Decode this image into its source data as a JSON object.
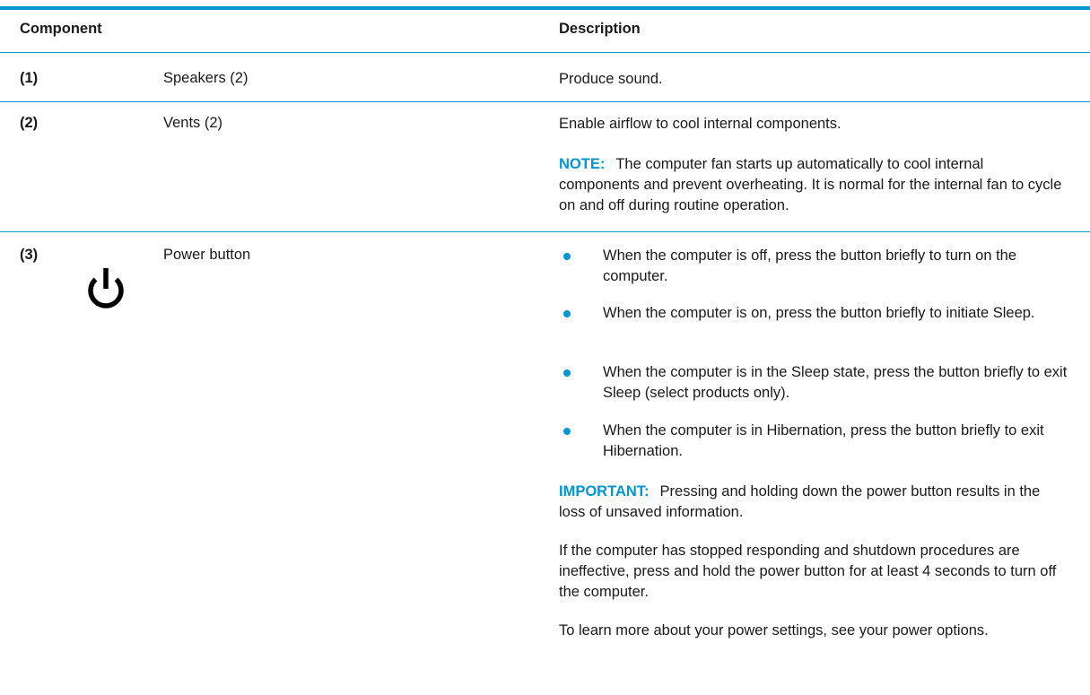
{
  "header": {
    "component": "Component",
    "description": "Description"
  },
  "rows": [
    {
      "number": "(1)",
      "name": "Speakers (2)",
      "description": "Produce sound."
    },
    {
      "number": "(2)",
      "name": "Vents (2)",
      "description": "Enable airflow to cool internal components.",
      "note_label": "NOTE:",
      "note_text": "The computer fan starts up automatically to cool internal components and prevent overheating. It is normal for the internal fan to cycle on and off during routine operation."
    },
    {
      "number": "(3)",
      "icon": "power-icon",
      "name": "Power button",
      "bullets": [
        "When the computer is off, press the button briefly to turn on the computer.",
        "When the computer is on, press the button briefly to initiate Sleep.",
        "When the computer is in the Sleep state, press the button briefly to exit Sleep (select products only).",
        "When the computer is in Hibernation, press the button briefly to exit Hibernation."
      ],
      "important_label": "IMPORTANT:",
      "important_text": "Pressing and holding down the power button results in the loss of unsaved information.",
      "paragraphs": [
        "If the computer has stopped responding and shutdown procedures are ineffective, press and hold the power button for at least 4 seconds to turn off the computer.",
        "To learn more about your power settings, see your power options."
      ]
    }
  ],
  "colors": {
    "accent": "#0096d6",
    "text": "#1a1a1a"
  }
}
